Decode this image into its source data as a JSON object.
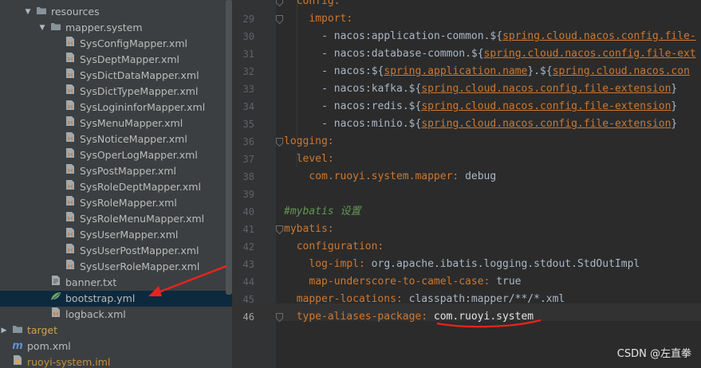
{
  "tree": [
    {
      "label": "resources",
      "icon": "folder-icon",
      "expanded": true
    },
    {
      "label": "mapper.system",
      "icon": "folder-icon",
      "expanded": true
    },
    {
      "label": "SysConfigMapper.xml",
      "icon": "xml-file-icon"
    },
    {
      "label": "SysDeptMapper.xml",
      "icon": "xml-file-icon"
    },
    {
      "label": "SysDictDataMapper.xml",
      "icon": "xml-file-icon"
    },
    {
      "label": "SysDictTypeMapper.xml",
      "icon": "xml-file-icon"
    },
    {
      "label": "SysLogininforMapper.xml",
      "icon": "xml-file-icon"
    },
    {
      "label": "SysMenuMapper.xml",
      "icon": "xml-file-icon"
    },
    {
      "label": "SysNoticeMapper.xml",
      "icon": "xml-file-icon"
    },
    {
      "label": "SysOperLogMapper.xml",
      "icon": "xml-file-icon"
    },
    {
      "label": "SysPostMapper.xml",
      "icon": "xml-file-icon"
    },
    {
      "label": "SysRoleDeptMapper.xml",
      "icon": "xml-file-icon"
    },
    {
      "label": "SysRoleMapper.xml",
      "icon": "xml-file-icon"
    },
    {
      "label": "SysRoleMenuMapper.xml",
      "icon": "xml-file-icon"
    },
    {
      "label": "SysUserMapper.xml",
      "icon": "xml-file-icon"
    },
    {
      "label": "SysUserPostMapper.xml",
      "icon": "xml-file-icon"
    },
    {
      "label": "SysUserRoleMapper.xml",
      "icon": "xml-file-icon"
    },
    {
      "label": "banner.txt",
      "icon": "text-file-icon"
    },
    {
      "label": "bootstrap.yml",
      "icon": "yaml-file-icon",
      "selected": true
    },
    {
      "label": "logback.xml",
      "icon": "xml-file-icon"
    },
    {
      "label": "target",
      "icon": "folder-icon",
      "expanded": false
    },
    {
      "label": "pom.xml",
      "icon": "maven-icon"
    },
    {
      "label": "ruoyi-system.iml",
      "icon": "iml-file-icon"
    }
  ],
  "editor": {
    "current_line": "46",
    "lines": [
      {
        "n": "",
        "t": "config:"
      },
      {
        "n": "29",
        "t": "import:"
      },
      {
        "n": "30",
        "t": "- nacos:application-common.${",
        "v": "spring.cloud.nacos.config.file-"
      },
      {
        "n": "31",
        "t": "- nacos:database-common.${",
        "v": "spring.cloud.nacos.config.file-ext"
      },
      {
        "n": "32",
        "t": "- nacos:${",
        "v": "spring.application.name",
        "t2": "}.${",
        "v2": "spring.cloud.nacos.con"
      },
      {
        "n": "33",
        "t": "- nacos:kafka.${",
        "v": "spring.cloud.nacos.config.file-extension",
        "t2": "}"
      },
      {
        "n": "34",
        "t": "- nacos:redis.${",
        "v": "spring.cloud.nacos.config.file-extension",
        "t2": "}"
      },
      {
        "n": "35",
        "t": "- nacos:minio.${",
        "v": "spring.cloud.nacos.config.file-extension",
        "t2": "}"
      },
      {
        "n": "36",
        "t": "logging:"
      },
      {
        "n": "37",
        "t": "level:"
      },
      {
        "n": "38",
        "t": "com.ruoyi.system.mapper:",
        "v": "debug"
      },
      {
        "n": "39",
        "t": ""
      },
      {
        "n": "40",
        "t": "#mybatis",
        "c": "设置"
      },
      {
        "n": "41",
        "t": "mybatis:"
      },
      {
        "n": "42",
        "t": "configuration:"
      },
      {
        "n": "43",
        "t": "log-impl:",
        "v": "org.apache.ibatis.logging.stdout.StdOutImpl"
      },
      {
        "n": "44",
        "t": "map-underscore-to-camel-case:",
        "v": "true"
      },
      {
        "n": "45",
        "t": "mapper-locations:",
        "v": "classpath:mapper/**/*.xml"
      },
      {
        "n": "46",
        "t": "type-aliases-package:",
        "v": "com.ruoyi.system"
      }
    ]
  },
  "watermark": "CSDN @左直拳",
  "colors": {
    "annotation_red": "#e8231f",
    "selection_bg": "#0d293e"
  }
}
